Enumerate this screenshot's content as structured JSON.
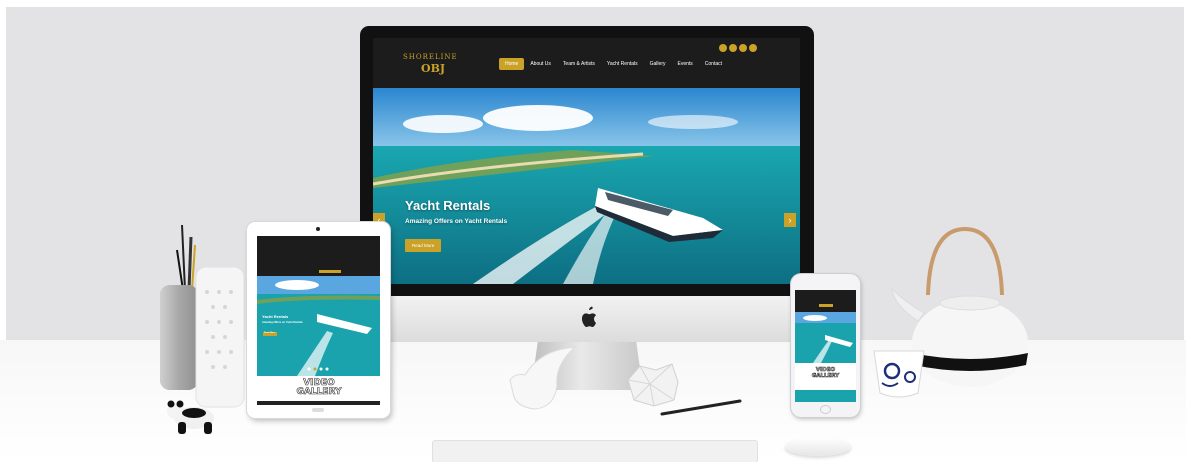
{
  "imac": {
    "site": {
      "logo_top": "SHORELINE",
      "logo_main": "OBJ",
      "nav": [
        "Home",
        "About Us",
        "Team & Artists",
        "Yacht Rentals",
        "Gallery",
        "Events",
        "Contact"
      ],
      "active_nav": "Home",
      "hero": {
        "title": "Yacht Rentals",
        "subtitle": "Amazing Offers on Yacht Rentals",
        "button": "Read More"
      }
    }
  },
  "ipad": {
    "hero_title": "Yacht Rentals",
    "hero_subtitle": "Amazing Offers on Yacht Rentals",
    "button": "Read More",
    "video_gallery_line1": "VIDEO",
    "video_gallery_line2": "GALLERY"
  },
  "iphone": {
    "video_gallery_line1": "VIDEO",
    "video_gallery_line2": "GALLERY"
  },
  "colors": {
    "accent_gold": "#c9a227",
    "nav_dark": "#1c1c1c",
    "sea": "#1fb3b8",
    "wall": "#e3e3e5"
  },
  "icons": [
    "apple-logo-icon",
    "chevron-left-icon",
    "chevron-right-icon",
    "facebook-icon",
    "twitter-icon",
    "instagram-icon",
    "mail-icon"
  ]
}
